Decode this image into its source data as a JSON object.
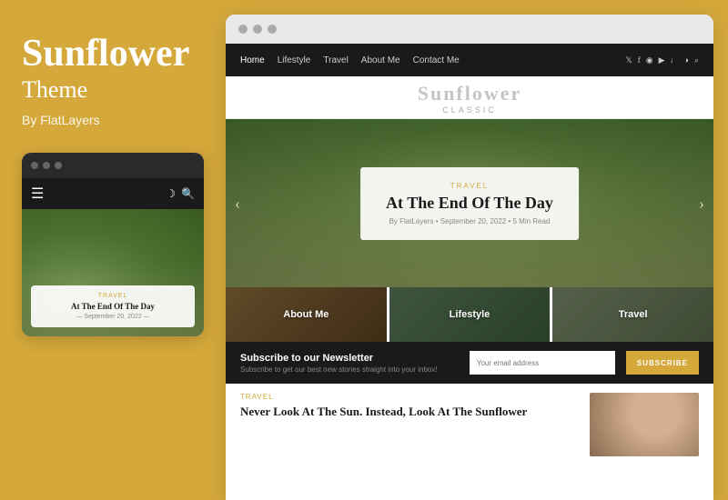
{
  "left": {
    "title": "Sunflower",
    "subtitle": "Theme",
    "by": "By FlatLayers"
  },
  "mobile": {
    "card_tag": "Travel",
    "card_title": "At The End Of The Day",
    "card_date": "September 20, 2022"
  },
  "browser": {
    "nav": {
      "links": [
        "Home",
        "Lifestyle",
        "Travel",
        "About Me",
        "Contact Me"
      ],
      "social_icons": [
        "𝕏",
        "f",
        "◉",
        "▶",
        "♪",
        "◑",
        "🔍"
      ]
    },
    "logo": "Sunflower",
    "logo_sub": "Classic",
    "hero": {
      "tag": "Travel",
      "title": "At The End Of The Day",
      "meta": "By FlatLayers  •  September 20, 2022  •  5 Min Read"
    },
    "categories": [
      "About Me",
      "Lifestyle",
      "Travel"
    ],
    "newsletter": {
      "title": "Subscribe to our Newsletter",
      "subtitle": "Subscribe to get our best new stories straight into your inbox!",
      "placeholder": "Your email address",
      "button": "SUBSCRIBE"
    },
    "article": {
      "tag": "Travel",
      "title": "Never Look At The Sun. Instead, Look At The Sunflower"
    }
  }
}
